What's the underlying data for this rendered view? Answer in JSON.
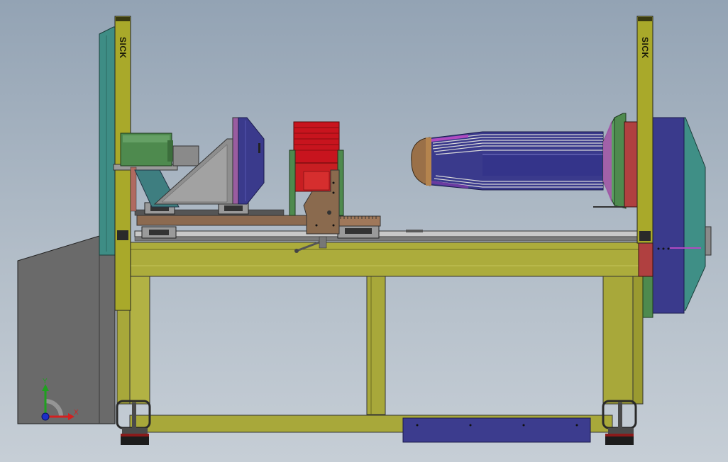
{
  "viewport": {
    "background_top": "#93a3b4",
    "background_bottom": "#c6ced6"
  },
  "model": {
    "left_sensor_brand": "SICK",
    "right_sensor_brand": "SICK"
  },
  "triad": {
    "y_label": "Y",
    "x_label": "X",
    "y_color": "#1fa01f",
    "x_color": "#d42020",
    "z_color": "#1d2fc8"
  },
  "colors": {
    "frame": "#a8a83a",
    "sensor_column": "#a9a92a",
    "control_cabinet": "#6d6d6d",
    "red_stack": "#c8141e",
    "blue_housing": "#3a3a8c",
    "teal_panel": "#3f8f86",
    "bottom_plate": "#3c3c8e"
  }
}
